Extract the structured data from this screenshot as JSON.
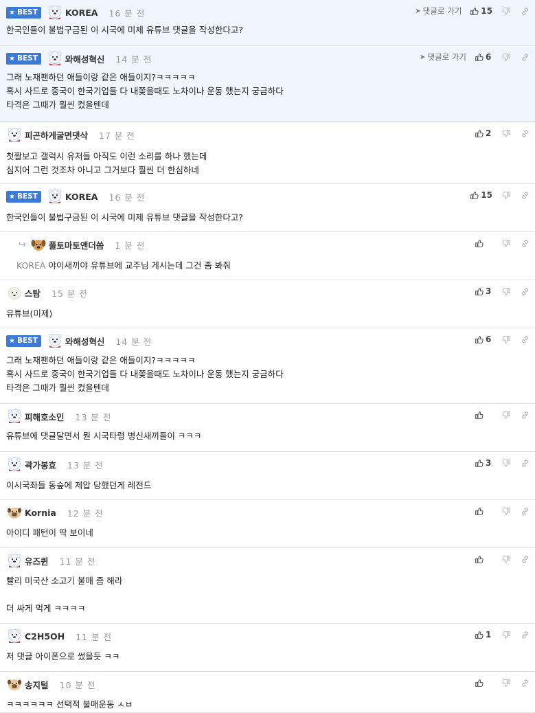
{
  "ui": {
    "best_label": "BEST",
    "goto_label": "댓글로 가기"
  },
  "comments": [
    {
      "id": 0,
      "best": true,
      "best_top": true,
      "avatar": "bear-avatar",
      "nick": "KOREA",
      "time": "16 분 전",
      "likes": "15",
      "goto": true,
      "lines": [
        "한국인들이 불법구금된 이 시국에 미제 유튜브 댓글을 작성한다고?"
      ]
    },
    {
      "id": 1,
      "best": true,
      "best_top": true,
      "avatar": "bear-avatar",
      "nick": "와해성혁신",
      "time": "14 분 전",
      "likes": "6",
      "goto": true,
      "lines": [
        "그래 노재팬하던 애들이랑 같은 애들이지?ㅋㅋㅋㅋㅋ",
        "혹시 사드로 중국이 한국기업들 다 내쫒을때도 노차이나 운동 했는지 궁금하다",
        "타격은 그때가 훨씬 컸을텐데"
      ]
    },
    {
      "id": 2,
      "best": false,
      "avatar": "bear-avatar",
      "nick": "피곤하게굴면댓삭",
      "time": "17 분 전",
      "likes": "2",
      "lines": [
        "첫짤보고 갤럭시 유저들 아직도 이런 소리를 하나 했는데",
        "심지어 그런 것조차 아니고 그거보다 훨씬 더 한심하네"
      ]
    },
    {
      "id": 3,
      "best": true,
      "avatar": "bear-avatar",
      "nick": "KOREA",
      "time": "16 분 전",
      "likes": "15",
      "lines": [
        "한국인들이 불법구금된 이 시국에 미제 유튜브 댓글을 작성한다고?"
      ]
    },
    {
      "id": 4,
      "best": false,
      "reply": true,
      "avatar": "dog-avatar",
      "nick": "풀토마토앤더씀",
      "time": "1 분 전",
      "likes": "",
      "ref": "KOREA",
      "lines": [
        "야이새끼야 유튜브에 교주님 게시는데 그건 좀 봐줘"
      ]
    },
    {
      "id": 5,
      "best": false,
      "avatar": "white-dog-avatar",
      "nick": "스탐",
      "time": "15 분 전",
      "likes": "3",
      "lines": [
        "유튜브(미제)"
      ]
    },
    {
      "id": 6,
      "best": true,
      "avatar": "bear-avatar",
      "nick": "와해성혁신",
      "time": "14 분 전",
      "likes": "6",
      "lines": [
        "그래 노재팬하던 애들이랑 같은 애들이지?ㅋㅋㅋㅋㅋ",
        "혹시 사드로 중국이 한국기업들 다 내쫒을때도 노차이나 운동 했는지 궁금하다",
        "타격은 그때가 훨씬 컸을텐데"
      ]
    },
    {
      "id": 7,
      "best": false,
      "avatar": "bear-avatar",
      "nick": "피해호소인",
      "time": "13 분 전",
      "likes": "",
      "lines": [
        "유튜브에 댓글달면서 뭔 시국타령 병신새끼들이 ㅋㅋㅋ"
      ]
    },
    {
      "id": 8,
      "best": false,
      "avatar": "bear-avatar",
      "nick": "곽가봉효",
      "time": "13 분 전",
      "likes": "3",
      "lines": [
        "이시국좌들 동숲에 제압 당했던게 레전드"
      ]
    },
    {
      "id": 9,
      "best": false,
      "avatar": "pug-avatar",
      "nick": "Kornia",
      "time": "12 분 전",
      "likes": "",
      "lines": [
        "아이디 패턴이 딱 보이네"
      ]
    },
    {
      "id": 10,
      "best": false,
      "avatar": "bear-avatar",
      "nick": "유즈퀸",
      "time": "11 분 전",
      "likes": "",
      "lines": [
        "빨리 미국산 소고기 불매 좀 해라",
        "",
        "더 싸게 먹게 ㅋㅋㅋㅋ"
      ]
    },
    {
      "id": 11,
      "best": false,
      "avatar": "bear-avatar",
      "nick": "C2H5OH",
      "time": "11 분 전",
      "likes": "1",
      "lines": [
        "저 댓글 아이폰으로 썼을듯 ㅋㅋ"
      ]
    },
    {
      "id": 12,
      "best": false,
      "avatar": "pug-avatar",
      "nick": "송지털",
      "time": "10 분 전",
      "likes": "",
      "lines": [
        "ㅋㅋㅋㅋㅋㅋ 선택적 불매운동 ㅅㅂ"
      ]
    }
  ]
}
